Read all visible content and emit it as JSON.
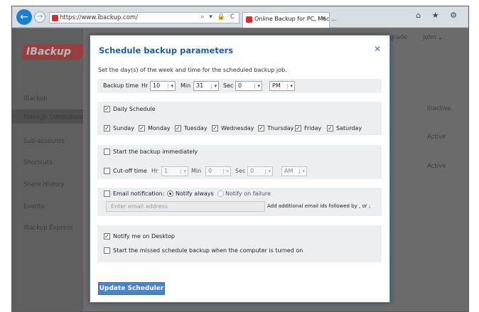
{
  "browser": {
    "address_url": "https://www.ibackup.com/",
    "tab_title": "Online Backup for PC, Mac ...",
    "tab_close": "×",
    "window_icons": "⌂ ★ ⚙",
    "nav_back": "←",
    "nav_forward": "→",
    "address_tools": "⌕ ▾ 🔒 C"
  },
  "page": {
    "logo_text": "IBackup",
    "top_upgrade": "Upgrade",
    "top_user": "John ⌄",
    "sidebar": [
      "IBackup",
      "Manage Computers",
      "Sub-accounts",
      "Shortcuts",
      "Share History",
      "Events",
      "IBackup Express"
    ],
    "statuses": [
      "Inactive",
      "Active",
      "Active"
    ]
  },
  "modal": {
    "title": "Schedule backup parameters",
    "close": "✕",
    "description": "Set the day(s) of the week and time for the scheduled backup job.",
    "backup_time": {
      "label": "Backup time",
      "hr_label": "Hr",
      "hr_value": "10",
      "min_label": "Min",
      "min_value": "31",
      "sec_label": "Sec",
      "sec_value": "0",
      "ampm_value": "PM"
    },
    "daily": {
      "label": "Daily Schedule",
      "checked": true,
      "days": [
        {
          "label": "Sunday",
          "checked": true
        },
        {
          "label": "Monday",
          "checked": true
        },
        {
          "label": "Tuesday",
          "checked": true
        },
        {
          "label": "Wednesday",
          "checked": true
        },
        {
          "label": "Thursday",
          "checked": true
        },
        {
          "label": "Friday",
          "checked": true
        },
        {
          "label": "Saturday",
          "checked": true
        }
      ]
    },
    "immediate": {
      "label": "Start the backup immediately",
      "checked": false
    },
    "cutoff": {
      "label": "Cut-off time",
      "checked": false,
      "hr_label": "Hr",
      "hr_value": "1",
      "min_label": "Min",
      "min_value": "0",
      "sec_label": "Sec",
      "sec_value": "0",
      "ampm_value": "AM"
    },
    "email": {
      "label": "Email notification:",
      "checked": false,
      "notify_always": "Notify always",
      "notify_failure": "Notify on failure",
      "placeholder": "Enter email address",
      "hint": "Add additional email ids followed by , or ;"
    },
    "desktop": {
      "label": "Notify me on Desktop",
      "checked": true
    },
    "missed": {
      "label": "Start the missed schedule backup when the computer is turned on",
      "checked": false
    },
    "update_button": "Update Scheduler"
  },
  "colors": {
    "accent": "#4b84c4",
    "title": "#1d5fa6",
    "brand_red": "#c62626"
  }
}
